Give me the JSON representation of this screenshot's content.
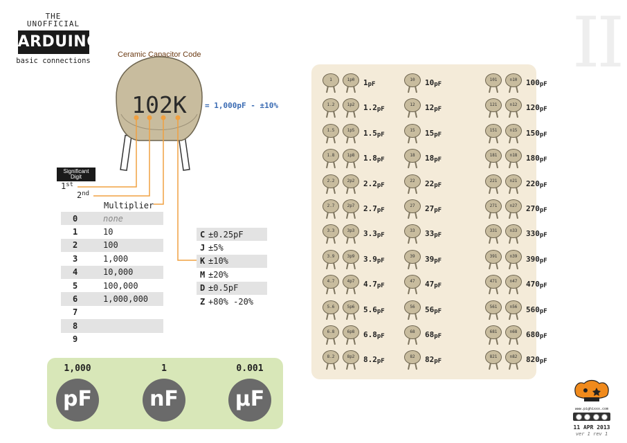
{
  "logo": {
    "line1": "THE",
    "line2": "UNOFFICIAL",
    "brand": "ARDUINO",
    "subtitle": "basic connections"
  },
  "page_numeral": "II",
  "capacitor": {
    "title": "Ceramic Capacitor Code",
    "code": "102K",
    "result": "= 1,000pF - ±10%",
    "significant_label_1": "Significant",
    "significant_label_2": "Digit",
    "ord1_num": "1",
    "ord1_suffix": "st",
    "ord2_num": "2",
    "ord2_suffix": "nd",
    "multiplier_label": "Multiplier",
    "colors": {
      "body": "#c8bc9e",
      "wire": "#f0a040",
      "text": "#2a2a2a"
    }
  },
  "multiplier_table": [
    {
      "digit": "0",
      "value": "none"
    },
    {
      "digit": "1",
      "value": "10"
    },
    {
      "digit": "2",
      "value": "100"
    },
    {
      "digit": "3",
      "value": "1,000"
    },
    {
      "digit": "4",
      "value": "10,000"
    },
    {
      "digit": "5",
      "value": "100,000"
    },
    {
      "digit": "6",
      "value": "1,000,000"
    },
    {
      "digit": "7",
      "value": ""
    },
    {
      "digit": "8",
      "value": ""
    },
    {
      "digit": "9",
      "value": ""
    }
  ],
  "tolerance_table": [
    {
      "code": "C",
      "value": "±0.25pF"
    },
    {
      "code": "J",
      "value": "±5%"
    },
    {
      "code": "K",
      "value": "±10%"
    },
    {
      "code": "M",
      "value": "±20%"
    },
    {
      "code": "D",
      "value": "±0.5pF"
    },
    {
      "code": "Z",
      "value": "+80% -20%"
    }
  ],
  "units": [
    {
      "value": "1,000",
      "symbol": "pF"
    },
    {
      "value": "1",
      "symbol": "nF"
    },
    {
      "value": "0.001",
      "symbol": "µF"
    }
  ],
  "capacitor_grid": {
    "columns": [
      [
        {
          "a": "1",
          "b": "1p0",
          "v": "1",
          "u": "pF"
        },
        {
          "a": "1.2",
          "b": "1p2",
          "v": "1.2",
          "u": "pF"
        },
        {
          "a": "1.5",
          "b": "1p5",
          "v": "1.5",
          "u": "pF"
        },
        {
          "a": "1.8",
          "b": "1p8",
          "v": "1.8",
          "u": "pF"
        },
        {
          "a": "2.2",
          "b": "2p2",
          "v": "2.2",
          "u": "pF"
        },
        {
          "a": "2.7",
          "b": "2p7",
          "v": "2.7",
          "u": "pF"
        },
        {
          "a": "3.3",
          "b": "3p3",
          "v": "3.3",
          "u": "pF"
        },
        {
          "a": "3.9",
          "b": "3p9",
          "v": "3.9",
          "u": "pF"
        },
        {
          "a": "4.7",
          "b": "4p7",
          "v": "4.7",
          "u": "pF"
        },
        {
          "a": "5.6",
          "b": "5p6",
          "v": "5.6",
          "u": "pF"
        },
        {
          "a": "6.8",
          "b": "6p8",
          "v": "6.8",
          "u": "pF"
        },
        {
          "a": "8.2",
          "b": "8p2",
          "v": "8.2",
          "u": "pF"
        }
      ],
      [
        {
          "a": "10",
          "v": "10",
          "u": "pF"
        },
        {
          "a": "12",
          "v": "12",
          "u": "pF"
        },
        {
          "a": "15",
          "v": "15",
          "u": "pF"
        },
        {
          "a": "18",
          "v": "18",
          "u": "pF"
        },
        {
          "a": "22",
          "v": "22",
          "u": "pF"
        },
        {
          "a": "27",
          "v": "27",
          "u": "pF"
        },
        {
          "a": "33",
          "v": "33",
          "u": "pF"
        },
        {
          "a": "39",
          "v": "39",
          "u": "pF"
        },
        {
          "a": "47",
          "v": "47",
          "u": "pF"
        },
        {
          "a": "56",
          "v": "56",
          "u": "pF"
        },
        {
          "a": "68",
          "v": "68",
          "u": "pF"
        },
        {
          "a": "82",
          "v": "82",
          "u": "pF"
        }
      ],
      [
        {
          "a": "101",
          "b": "n10",
          "v": "100",
          "u": "pF"
        },
        {
          "a": "121",
          "b": "n12",
          "v": "120",
          "u": "pF"
        },
        {
          "a": "151",
          "b": "n15",
          "v": "150",
          "u": "pF"
        },
        {
          "a": "181",
          "b": "n18",
          "v": "180",
          "u": "pF"
        },
        {
          "a": "221",
          "b": "n21",
          "v": "220",
          "u": "pF"
        },
        {
          "a": "271",
          "b": "n27",
          "v": "270",
          "u": "pF"
        },
        {
          "a": "331",
          "b": "n33",
          "v": "330",
          "u": "pF"
        },
        {
          "a": "391",
          "b": "n39",
          "v": "390",
          "u": "pF"
        },
        {
          "a": "471",
          "b": "n47",
          "v": "470",
          "u": "pF"
        },
        {
          "a": "561",
          "b": "n56",
          "v": "560",
          "u": "pF"
        },
        {
          "a": "681",
          "b": "n68",
          "v": "680",
          "u": "pF"
        },
        {
          "a": "821",
          "b": "n82",
          "v": "820",
          "u": "pF"
        }
      ]
    ]
  },
  "footer": {
    "site": "www.pighixxx.com",
    "date": "11 APR 2013",
    "version": "ver 1 rev 1"
  }
}
